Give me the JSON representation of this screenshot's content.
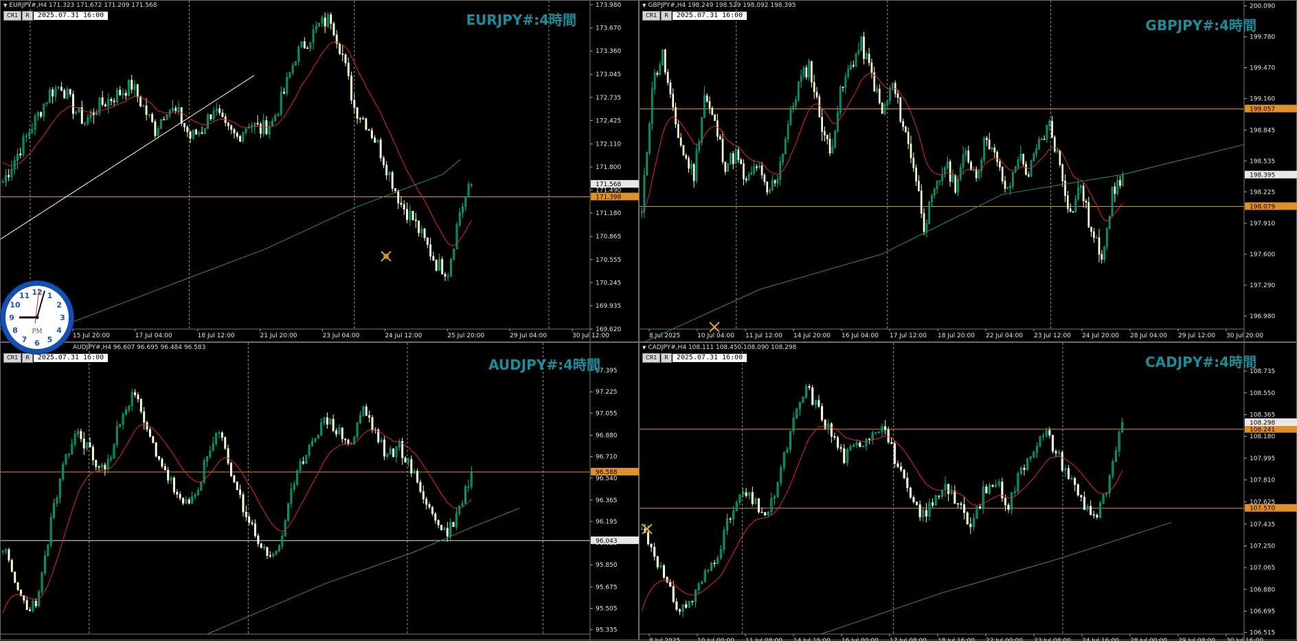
{
  "clock": {
    "label": "PM",
    "numerals": [
      "12",
      "1",
      "2",
      "3",
      "4",
      "5",
      "6",
      "7",
      "8",
      "9",
      "10",
      "11"
    ]
  },
  "colors": {
    "bull": "#00c087",
    "bullFill": "#0a7a5a",
    "bear": "#f8ffd0",
    "ma_fast": "#e32828",
    "ma_slow": "#2f8f61",
    "hline": "#e0902a",
    "title": "#1b8d9a",
    "grid": "#9a9a9a",
    "axisText": "#e6e6e6",
    "priceTag": "#e8a33d"
  },
  "charts": [
    {
      "id": "eurjpy",
      "header": "EURJPY#,H4  171.323 171.672 171.209 171.568",
      "btn_cr": "CR1",
      "btn_r": "R",
      "datetime": "2025.07.31  16:00",
      "title": "EURJPY#:4時間",
      "price_ticks": [
        "173.980",
        "173.670",
        "173.360",
        "173.045",
        "172.735",
        "172.425",
        "172.110",
        "171.800",
        "171.490",
        "171.180",
        "170.865",
        "170.555",
        "170.245",
        "169.935",
        "169.620"
      ],
      "ylim": [
        169.62,
        173.98
      ],
      "time_ticks": [
        "20:00",
        "15 Jul 20:00",
        "17 Jul 04:00",
        "18 Jul 12:00",
        "21 Jul 20:00",
        "23 Jul 04:00",
        "24 Jul 12:00",
        "25 Jul 20:00",
        "29 Jul 04:00",
        "30 Jul 12:00"
      ],
      "vlines": [
        0.05,
        0.32,
        0.6,
        0.93
      ],
      "hline": 171.398,
      "hline_label": "171.398",
      "current_label": "171.568",
      "current": 171.568,
      "trendline": [
        [
          0.0,
          170.83
        ],
        [
          0.43,
          173.03
        ]
      ],
      "seed": 7,
      "path": [
        171.6,
        171.9,
        172.2,
        172.5,
        172.8,
        172.9,
        172.6,
        172.4,
        172.6,
        172.7,
        172.8,
        172.9,
        172.6,
        172.3,
        172.6,
        172.5,
        172.2,
        172.3,
        172.6,
        172.3,
        172.2,
        172.4,
        172.3,
        172.4,
        172.8,
        173.3,
        173.5,
        173.7,
        173.8,
        173.3,
        172.6,
        172.4,
        172.1,
        171.7,
        171.3,
        171.1,
        170.8,
        170.5,
        170.4,
        171.2,
        171.57
      ],
      "ma_fast_start": 171.9,
      "ma_slow": [
        [
          0.05,
          169.5
        ],
        [
          0.25,
          170.1
        ],
        [
          0.45,
          170.7
        ],
        [
          0.6,
          171.25
        ],
        [
          0.75,
          171.7
        ],
        [
          0.78,
          171.9
        ]
      ]
    },
    {
      "id": "gbpjpy",
      "header": "GBPJPY#,H4  198.249 198.529 198.092 198.395",
      "btn_cr": "CR1",
      "btn_r": "R",
      "datetime": "2025.07.31  16:00",
      "title": "GBPJPY#:4時間",
      "price_ticks": [
        "200.090",
        "199.780",
        "199.470",
        "199.160",
        "198.845",
        "198.535",
        "198.225",
        "197.910",
        "197.600",
        "197.290",
        "196.980"
      ],
      "ylim": [
        196.85,
        200.1
      ],
      "time_ticks": [
        "8 Jul 2025",
        "10 Jul 04:00",
        "11 Jul 12:00",
        "14 Jul 20:00",
        "16 Jul 04:00",
        "17 Jul 12:00",
        "18 Jul 20:00",
        "22 Jul 04:00",
        "23 Jul 12:00",
        "24 Jul 20:00",
        "28 Jul 04:00",
        "29 Jul 12:00",
        "30 Jul 20:00"
      ],
      "vlines": [
        0.16,
        0.41,
        0.68
      ],
      "hline": 198.079,
      "hline_label": "198.079",
      "hline2": 199.057,
      "hline2_label": "199.057",
      "current_label": "198.395",
      "current": 198.395,
      "seed": 11,
      "path": [
        198.0,
        199.3,
        199.6,
        199.0,
        198.6,
        198.4,
        199.2,
        198.9,
        198.5,
        198.6,
        198.3,
        198.5,
        198.2,
        198.4,
        198.9,
        199.3,
        199.5,
        199.0,
        198.6,
        199.2,
        199.5,
        199.7,
        199.4,
        199.0,
        199.3,
        198.9,
        198.5,
        197.9,
        198.2,
        198.5,
        198.3,
        198.6,
        198.4,
        198.8,
        198.5,
        198.2,
        198.6,
        198.4,
        198.7,
        198.9,
        198.5,
        198.0,
        198.3,
        197.8,
        197.6,
        198.2,
        198.4
      ],
      "ma_fast_start": 198.0,
      "ma_slow": [
        [
          0.0,
          196.7
        ],
        [
          0.2,
          197.25
        ],
        [
          0.4,
          197.6
        ],
        [
          0.5,
          197.9
        ],
        [
          0.6,
          198.2
        ],
        [
          0.8,
          198.4
        ],
        [
          1.0,
          198.7
        ]
      ]
    },
    {
      "id": "audjpy",
      "header": "AUDJPY#,H4  96.607 96.695 96.484 96.583",
      "btn_cr": "CR1",
      "btn_r": "R",
      "datetime": "2025.07.31  16:00",
      "title": "AUDJPY#:4時間",
      "price_ticks": [
        "97.395",
        "97.225",
        "97.055",
        "96.880",
        "96.710",
        "96.540",
        "96.365",
        "96.195",
        "96.025",
        "95.850",
        "95.675",
        "95.505",
        "95.335"
      ],
      "ylim": [
        95.3,
        97.45
      ],
      "time_ticks": [],
      "vlines": [
        0.15,
        0.42,
        0.69,
        0.92
      ],
      "hline": 96.588,
      "hline_label": "96.588",
      "hline2": 96.043,
      "hline2_label": "96.043",
      "hline2_color": "#e8e8e8",
      "current_label": "96.588",
      "current": 96.583,
      "seed": 23,
      "path": [
        96.0,
        95.7,
        95.5,
        95.6,
        96.2,
        96.6,
        96.9,
        96.8,
        96.6,
        96.7,
        97.1,
        97.2,
        96.9,
        96.7,
        96.5,
        96.3,
        96.4,
        96.7,
        96.9,
        96.6,
        96.3,
        96.1,
        95.9,
        96.0,
        96.4,
        96.7,
        96.9,
        97.0,
        96.9,
        96.8,
        97.1,
        96.9,
        96.7,
        96.8,
        96.6,
        96.4,
        96.2,
        96.1,
        96.3,
        96.58
      ],
      "ma_fast_start": 95.4,
      "ma_slow": [
        [
          0.35,
          95.3
        ],
        [
          0.55,
          95.7
        ],
        [
          0.7,
          95.95
        ],
        [
          0.8,
          96.15
        ],
        [
          0.88,
          96.3
        ]
      ]
    },
    {
      "id": "cadjpy",
      "header": "CADJPY#,H4  108.111 108.450 108.090 108.298",
      "btn_cr": "CR1",
      "btn_r": "R",
      "datetime": "2025.07.31  16:00",
      "title": "CADJPY#:4時間",
      "price_ticks": [
        "108.735",
        "108.550",
        "108.365",
        "108.180",
        "107.995",
        "107.810",
        "107.625",
        "107.435",
        "107.250",
        "107.065",
        "106.880",
        "106.695",
        "106.515"
      ],
      "ylim": [
        106.5,
        108.8
      ],
      "time_ticks": [
        "8 Jul 2025",
        "10 Jul 00:00",
        "11 Jul 08:00",
        "14 Jul 16:00",
        "16 Jul 00:00",
        "17 Jul 08:00",
        "18 Jul 16:00",
        "22 Jul 00:00",
        "23 Jul 08:00",
        "24 Jul 16:00",
        "28 Jul 00:00",
        "29 Jul 08:00",
        "30 Jul 16:00"
      ],
      "vlines": [
        0.17,
        0.42,
        0.7
      ],
      "hline": 108.241,
      "hline_label": "108.241",
      "hline2": 107.57,
      "hline2_label": "107.570",
      "current_label": "108.298",
      "current": 108.298,
      "seed": 31,
      "path": [
        107.4,
        107.2,
        106.9,
        106.7,
        106.8,
        107.0,
        107.2,
        107.5,
        107.7,
        107.6,
        107.5,
        107.9,
        108.3,
        108.6,
        108.4,
        108.2,
        108.0,
        108.1,
        108.2,
        108.3,
        108.0,
        107.7,
        107.5,
        107.6,
        107.8,
        107.6,
        107.4,
        107.7,
        107.8,
        107.6,
        107.9,
        108.1,
        108.2,
        108.0,
        107.8,
        107.6,
        107.5,
        107.8,
        108.3
      ],
      "ma_fast_start": 106.6,
      "ma_slow": [
        [
          0.3,
          106.5
        ],
        [
          0.5,
          106.85
        ],
        [
          0.7,
          107.15
        ],
        [
          0.85,
          107.4
        ],
        [
          0.88,
          107.45
        ]
      ]
    }
  ]
}
